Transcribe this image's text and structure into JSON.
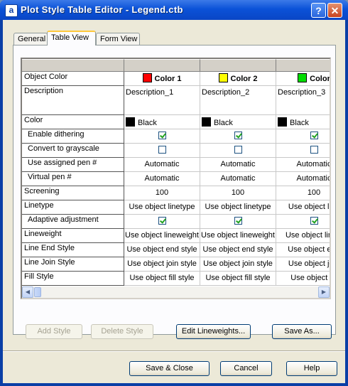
{
  "window": {
    "title": "Plot Style Table Editor - Legend.ctb",
    "app_icon": "a",
    "help_glyph": "?",
    "close_glyph": "✕"
  },
  "tabs": [
    {
      "label": "General"
    },
    {
      "label": "Table View",
      "selected": true
    },
    {
      "label": "Form View"
    }
  ],
  "grid": {
    "row_labels": {
      "object_color": "Object Color",
      "description": "Description",
      "color": "Color",
      "enable_dithering": "Enable dithering",
      "convert_grayscale": "Convert to grayscale",
      "use_assigned_pen": "Use assigned pen #",
      "virtual_pen": "Virtual pen #",
      "screening": "Screening",
      "linetype": "Linetype",
      "adaptive_adjustment": "Adaptive adjustment",
      "lineweight": "Lineweight",
      "line_end_style": "Line End Style",
      "line_join_style": "Line Join Style",
      "fill_style": "Fill Style"
    },
    "columns": [
      {
        "name": "Color 1",
        "swatch": "#ff0000",
        "description": "Description_1",
        "color": "Black",
        "color_swatch": "#000000",
        "dithering": true,
        "grayscale": false,
        "assigned_pen": "Automatic",
        "virtual_pen": "Automatic",
        "screening": "100",
        "linetype": "Use object linetype",
        "adaptive": true,
        "lineweight": "Use object lineweight",
        "end_style": "Use object end style",
        "join_style": "Use object join style",
        "fill_style": "Use object fill style"
      },
      {
        "name": "Color 2",
        "swatch": "#ffff00",
        "description": "Description_2",
        "color": "Black",
        "color_swatch": "#000000",
        "dithering": true,
        "grayscale": false,
        "assigned_pen": "Automatic",
        "virtual_pen": "Automatic",
        "screening": "100",
        "linetype": "Use object linetype",
        "adaptive": true,
        "lineweight": "Use object lineweight",
        "end_style": "Use object end style",
        "join_style": "Use object join style",
        "fill_style": "Use object fill style"
      },
      {
        "name": "Color",
        "swatch": "#00dd00",
        "description": "Description_3",
        "color": "Black",
        "color_swatch": "#000000",
        "dithering": true,
        "grayscale": false,
        "assigned_pen": "Automatic",
        "virtual_pen": "Automatic",
        "screening": "100",
        "linetype": "Use object line",
        "adaptive": true,
        "lineweight": "Use object linew",
        "end_style": "Use object end",
        "join_style": "Use object join",
        "fill_style": "Use object fill"
      }
    ]
  },
  "buttons": {
    "add_style": "Add Style",
    "delete_style": "Delete Style",
    "edit_lineweights": "Edit Lineweights...",
    "save_as": "Save As...",
    "save_close": "Save & Close",
    "cancel": "Cancel",
    "help": "Help"
  },
  "scroll_arrows": {
    "left": "◀",
    "right": "▶"
  }
}
